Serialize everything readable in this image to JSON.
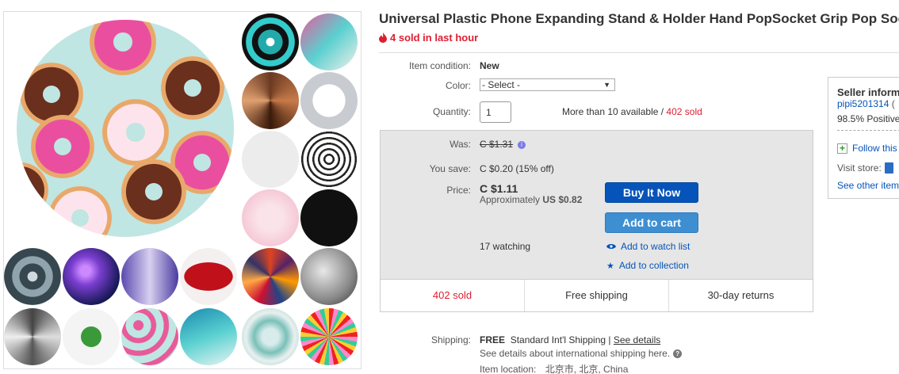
{
  "colors": {
    "accent_red": "#dd1e31",
    "link_blue": "#0654ba",
    "buy_button": "#0654ba",
    "cart_button": "#3d8fd1"
  },
  "title": "Universal Plastic Phone Expanding Stand & Holder Hand PopSocket Grip Pop Socket",
  "sold_hour": "4 sold in last hour",
  "condition": {
    "label": "Item condition:",
    "value": "New"
  },
  "color": {
    "label": "Color:",
    "selected": "- Select -"
  },
  "quantity": {
    "label": "Quantity:",
    "value": "1",
    "available": "More than 10 available / ",
    "sold": "402 sold"
  },
  "price": {
    "was_label": "Was:",
    "was_value": "C $1.31",
    "save_label": "You save:",
    "save_value": "C $0.20 (15% off)",
    "price_label": "Price:",
    "price_value": "C $1.11",
    "approx_prefix": "Approximately ",
    "approx_value": "US $0.82",
    "buy_now": "Buy It Now",
    "add_cart": "Add to cart",
    "watching": "17 watching",
    "watch_list": "Add to watch list",
    "collection": "Add to collection"
  },
  "footer": {
    "sold": "402 sold",
    "shipping": "Free shipping",
    "returns": "30-day returns"
  },
  "shipping": {
    "label": "Shipping:",
    "free": "FREE",
    "method": "Standard Int'l Shipping",
    "sep": " | ",
    "details": "See details",
    "note": "See details about international shipping here.",
    "location_label": "Item location:",
    "location": "北京市, 北京, China"
  },
  "seller": {
    "title": "Seller information",
    "name": "pipi5201314",
    "name_suffix": " (",
    "positive": "98.5% Positive",
    "follow": "Follow this seller",
    "visit": "Visit store:",
    "other": "See other items"
  },
  "icons": [
    "flame-icon",
    "info-icon",
    "eye-icon",
    "star-icon",
    "question-icon",
    "plus-icon",
    "store-icon",
    "chevron-down-icon"
  ]
}
